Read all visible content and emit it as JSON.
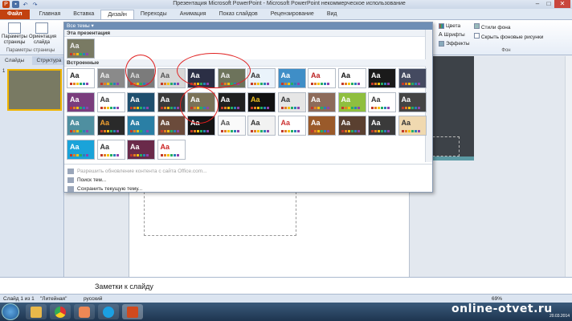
{
  "titlebar": {
    "title": "Презентация Microsoft PowerPoint - Microsoft PowerPoint некоммерческое использование",
    "qat_icons": [
      "powerpoint-icon",
      "save-icon",
      "undo-icon",
      "redo-icon"
    ],
    "window_controls": [
      "–",
      "□",
      "✕"
    ]
  },
  "tabs": [
    "Файл",
    "Главная",
    "Вставка",
    "Дизайн",
    "Переходы",
    "Анимация",
    "Показ слайдов",
    "Рецензирование",
    "Вид"
  ],
  "active_tab": "Дизайн",
  "ribbon": {
    "page_setup_label": "Параметры страницы",
    "orientation_label": "Ориентация слайда",
    "group_label": "Параметры страницы",
    "colors": "Цвета",
    "fonts": "Шрифты",
    "effects": "Эффекты",
    "bg_styles": "Стили фона",
    "hide_bg": "Скрыть фоновые рисунки",
    "bg_group": "Фон"
  },
  "left_pane": {
    "tabs": [
      "Слайды",
      "Структура"
    ],
    "slide_number": "1"
  },
  "gallery": {
    "header": "Все темы ▾",
    "this_presentation": "Эта презентация",
    "builtin": "Встроенные",
    "links": [
      {
        "label": "Разрешить обновление контента с сайта Office.com...",
        "disabled": true
      },
      {
        "label": "Поиск тем...",
        "disabled": false
      },
      {
        "label": "Сохранить текущую тему...",
        "disabled": false
      }
    ],
    "themes": [
      {
        "bg": "#ffffff",
        "fg": "#222"
      },
      {
        "bg": "#8a8a8a",
        "fg": "#eee"
      },
      {
        "bg": "#7b7b7b",
        "fg": "#ddd"
      },
      {
        "bg": "#d7d7d7",
        "fg": "#555"
      },
      {
        "bg": "#2b2f45",
        "fg": "#fff"
      },
      {
        "bg": "#6d735b",
        "fg": "#eee"
      },
      {
        "bg": "#eaf3fb",
        "fg": "#333"
      },
      {
        "bg": "#3f8ec7",
        "fg": "#fff"
      },
      {
        "bg": "#ffffff",
        "fg": "#b22"
      },
      {
        "bg": "#ffffff",
        "fg": "#111"
      },
      {
        "bg": "#1a1a1a",
        "fg": "#fff"
      },
      {
        "bg": "#444a60",
        "fg": "#fff"
      },
      {
        "bg": "#7a3d7d",
        "fg": "#fff"
      },
      {
        "bg": "#ffffff",
        "fg": "#333"
      },
      {
        "bg": "#1f4f6e",
        "fg": "#fff"
      },
      {
        "bg": "#3a3a3a",
        "fg": "#fff"
      },
      {
        "bg": "#7a7258",
        "fg": "#fff"
      },
      {
        "bg": "#202020",
        "fg": "#fff"
      },
      {
        "bg": "#111111",
        "fg": "#f0c020"
      },
      {
        "bg": "#e6e6e6",
        "fg": "#333"
      },
      {
        "bg": "#8d6b5a",
        "fg": "#fff"
      },
      {
        "bg": "#8fbf3f",
        "fg": "#fff"
      },
      {
        "bg": "#ffffff",
        "fg": "#333"
      },
      {
        "bg": "#444444",
        "fg": "#fff"
      },
      {
        "bg": "#4f8fa0",
        "fg": "#fff"
      },
      {
        "bg": "#2a2a2a",
        "fg": "#f0a030"
      },
      {
        "bg": "#2a7fa5",
        "fg": "#fff"
      },
      {
        "bg": "#6b4b3b",
        "fg": "#fff"
      },
      {
        "bg": "#151515",
        "fg": "#fff"
      },
      {
        "bg": "#fafafa",
        "fg": "#555"
      },
      {
        "bg": "#f2f2f2",
        "fg": "#333"
      },
      {
        "bg": "#ffffff",
        "fg": "#c33"
      },
      {
        "bg": "#9a5a2a",
        "fg": "#fff"
      },
      {
        "bg": "#5a4030",
        "fg": "#fff"
      },
      {
        "bg": "#3a3a3a",
        "fg": "#fff"
      },
      {
        "bg": "#f0d9b0",
        "fg": "#333"
      },
      {
        "bg": "#1aa3d9",
        "fg": "#fff"
      },
      {
        "bg": "#ffffff",
        "fg": "#333"
      },
      {
        "bg": "#6a2a4a",
        "fg": "#fff"
      },
      {
        "bg": "#ffffff",
        "fg": "#c22"
      }
    ],
    "swatch_colors": [
      "#c0392b",
      "#e67e22",
      "#f1c40f",
      "#27ae60",
      "#2980b9",
      "#8e44ad"
    ]
  },
  "notes": "Заметки к слайду",
  "status": {
    "slide": "Слайд 1 из 1",
    "theme": "\"Литейная\"",
    "lang": "русский",
    "zoom": "69%"
  },
  "taskbar": {
    "icons": [
      "start-icon",
      "explorer-icon",
      "chrome-icon",
      "media-player-icon",
      "skype-icon",
      "powerpoint-icon"
    ],
    "watermark": "online-otvet.ru",
    "date": "20.03.2014"
  }
}
